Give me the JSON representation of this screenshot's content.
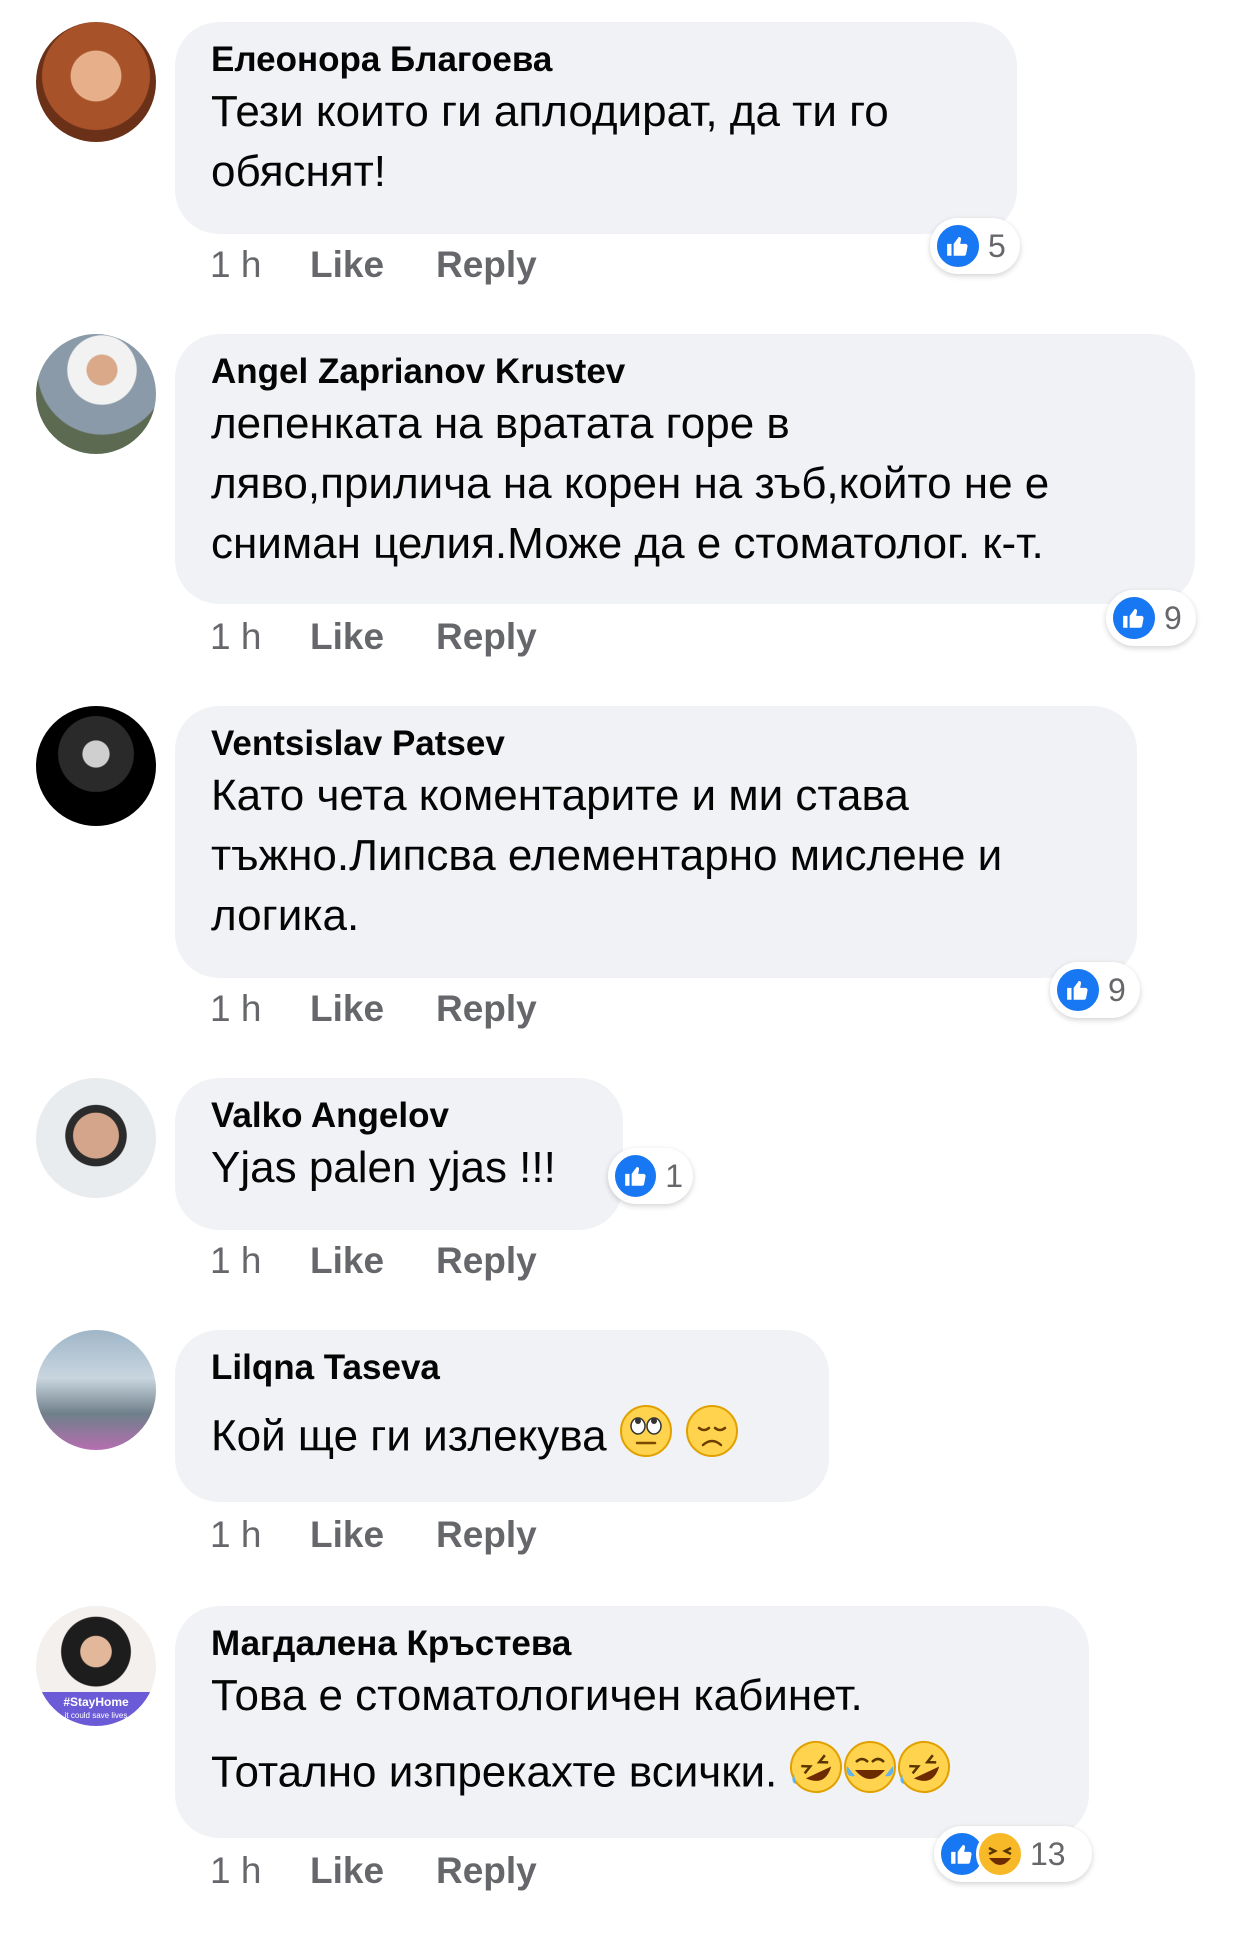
{
  "comments": [
    {
      "name": "Елеонора Благоева",
      "lines": [
        "Тези които ги аплодират, да ти го",
        "обяснят!"
      ],
      "time": "1 h",
      "like_label": "Like",
      "reply_label": "Reply",
      "reaction_count": "5"
    },
    {
      "name": "Angel Zaprianov Krustev",
      "lines": [
        "лепенката на вратата горе в",
        "ляво,прилича на корен на зъб,който не е",
        "сниман целия.Може да е стоматолог. к-т."
      ],
      "time": "1 h",
      "like_label": "Like",
      "reply_label": "Reply",
      "reaction_count": "9"
    },
    {
      "name": "Ventsislav Patsev",
      "lines": [
        "Като чета коментарите и ми става",
        "тъжно.Липсва елементарно мислене и",
        "логика."
      ],
      "time": "1 h",
      "like_label": "Like",
      "reply_label": "Reply",
      "reaction_count": "9"
    },
    {
      "name": "Valko Angelov",
      "lines": [
        "Yjas palen yjas !!!"
      ],
      "time": "1 h",
      "like_label": "Like",
      "reply_label": "Reply",
      "reaction_count": "1"
    },
    {
      "name": "Lilqna Taseva",
      "lines": [
        "Кой ще ги излекува"
      ],
      "time": "1 h",
      "like_label": "Like",
      "reply_label": "Reply",
      "emojis": [
        "eye-roll-emoji",
        "disappointed-emoji"
      ]
    },
    {
      "name": "Магдалена Кръстева",
      "lines": [
        "Това е стоматологичен кабинет.",
        "Тотално изпрекахте всички."
      ],
      "time": "1 h",
      "like_label": "Like",
      "reply_label": "Reply",
      "reaction_count": "13",
      "avatar_badge": "#StayHome",
      "avatar_badge_sub": "it could save lives",
      "emojis": [
        "rofl-emoji",
        "crying-laughing-emoji",
        "rofl-emoji"
      ]
    }
  ],
  "colors": {
    "bubble": "#f0f2f5",
    "meta": "#65676b",
    "like_blue": "#1877f2",
    "haha_yellow": "#f7b928"
  },
  "icons": [
    "like-reaction-icon",
    "haha-reaction-icon"
  ]
}
